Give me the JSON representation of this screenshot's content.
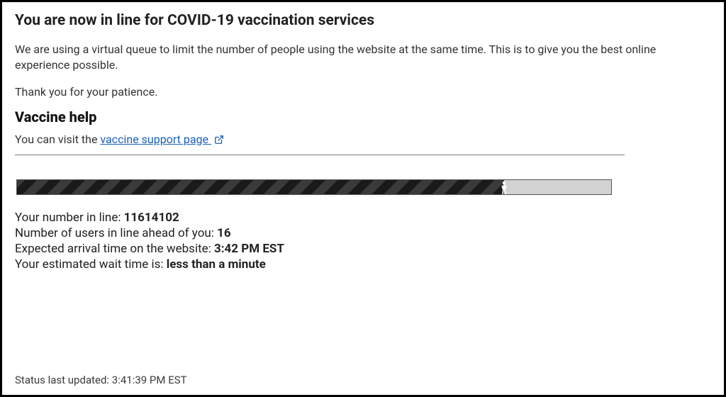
{
  "page": {
    "title": "You are now in line for COVID-19 vaccination services",
    "intro": "We are using a virtual queue to limit the number of people using the website at the same time. This is to give you the best online experience possible.",
    "thanks": "Thank you for your patience."
  },
  "help": {
    "heading": "Vaccine help",
    "prefix": "You can visit the ",
    "link_text": "vaccine support page"
  },
  "progress": {
    "percent": 82
  },
  "stats": {
    "number_label": "Your number in line: ",
    "number_value": "11614102",
    "ahead_label": "Number of users in line ahead of you: ",
    "ahead_value": "16",
    "eta_label": "Expected arrival time on the website: ",
    "eta_value": "3:42 PM EST",
    "wait_label": "Your estimated wait time is: ",
    "wait_value": "less than a minute"
  },
  "status": {
    "label": "Status last updated: ",
    "value": "3:41:39 PM EST"
  }
}
